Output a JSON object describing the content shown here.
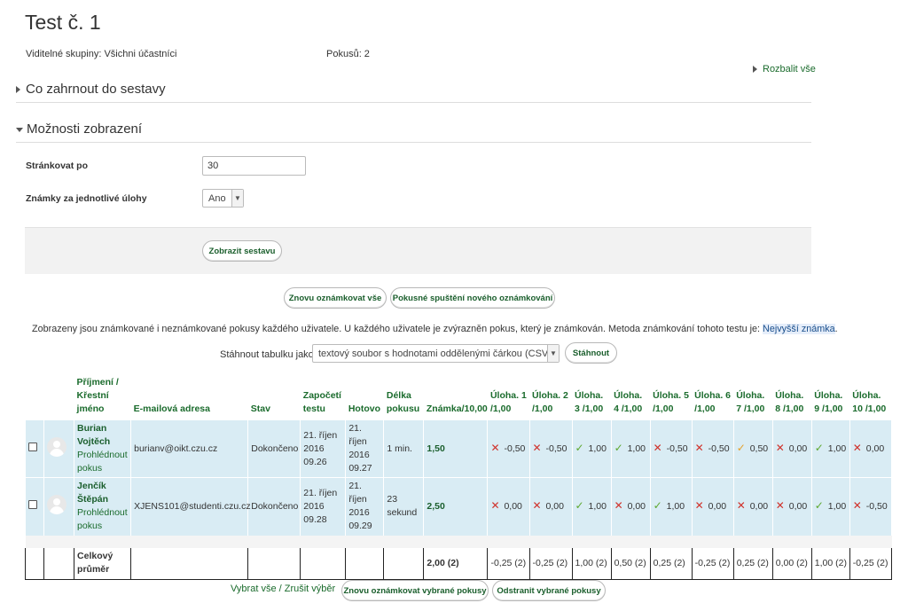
{
  "page": {
    "title": "Test č. 1",
    "groups_text": "Viditelné skupiny: Všichni účastníci",
    "attempts_text": "Pokusů: 2",
    "expand_all": "Rozbalit vše"
  },
  "sections": {
    "include": "Co zahrnout do sestavy",
    "display": "Možnosti zobrazení"
  },
  "form": {
    "page_size_label": "Stránkovat po",
    "page_size_value": "30",
    "marks_label": "Známky za jednotlivé úlohy",
    "marks_value": "Ano",
    "show_report_button": "Zobrazit sestavu"
  },
  "actions": {
    "regrade_all": "Znovu oznámkovat vše",
    "dry_run": "Pokusné spuštění nového oznámkování"
  },
  "info": {
    "text_before": "Zobrazeny jsou známkované i neznámkované pokusy každého uživatele. U každého uživatele je zvýrazněn pokus, který je známkován. Metoda známkování tohoto testu je: ",
    "method": "Nejvyšší známka",
    "text_after": "."
  },
  "download": {
    "label": "Stáhnout tabulku jako",
    "format": "textový soubor s hodnotami oddělenými čárkou (CSV)",
    "button": "Stáhnout"
  },
  "table": {
    "headers": {
      "name": "Příjmení / Křestní jméno",
      "email": "E-mailová adresa",
      "state": "Stav",
      "started": "Započetí testu",
      "finished": "Hotovo",
      "duration": "Délka pokusu",
      "grade": "Známka/10,00",
      "q1": "Úloha. 1 /1,00",
      "q2": "Úloha. 2 /1,00",
      "q3": "Úloha. 3 /1,00",
      "q4": "Úloha. 4 /1,00",
      "q5": "Úloha. 5 /1,00",
      "q6": "Úloha. 6 /1,00",
      "q7": "Úloha. 7 /1,00",
      "q8": "Úloha. 8 /1,00",
      "q9": "Úloha. 9 /1,00",
      "q10": "Úloha. 10 /1,00"
    },
    "rows": [
      {
        "name": "Burian Vojtěch",
        "review": "Prohlédnout pokus",
        "email": "burianv@oikt.czu.cz",
        "state": "Dokončeno",
        "started": "21. říjen 2016 09.26",
        "finished": "21. říjen 2016 09.27",
        "duration": "1 min.",
        "grade": "1,50",
        "q": [
          "-0,50",
          "-0,50",
          "1,00",
          "1,00",
          "-0,50",
          "-0,50",
          "0,50",
          "0,00",
          "1,00",
          "0,00"
        ],
        "qicon": [
          "x",
          "x",
          "ok",
          "ok",
          "x",
          "x",
          "part",
          "x",
          "ok",
          "x"
        ]
      },
      {
        "name": "Jenčík Štěpán",
        "review": "Prohlédnout pokus",
        "email": "XJENS101@studenti.czu.cz",
        "state": "Dokončeno",
        "started": "21. říjen 2016 09.28",
        "finished": "21. říjen 2016 09.29",
        "duration": "23 sekund",
        "grade": "2,50",
        "q": [
          "0,00",
          "0,00",
          "1,00",
          "0,00",
          "1,00",
          "0,00",
          "0,00",
          "0,00",
          "1,00",
          "-0,50"
        ],
        "qicon": [
          "x",
          "x",
          "ok",
          "x",
          "ok",
          "x",
          "x",
          "x",
          "ok",
          "x"
        ]
      }
    ],
    "average": {
      "label": "Celkový průměr",
      "grade": "2,00 (2)",
      "q": [
        "-0,25 (2)",
        "-0,25 (2)",
        "1,00 (2)",
        "0,50 (2)",
        "0,25 (2)",
        "-0,25 (2)",
        "0,25 (2)",
        "0,00 (2)",
        "1,00 (2)",
        "-0,25 (2)"
      ]
    }
  },
  "bottom": {
    "select_all": "Vybrat vše",
    "separator": " / ",
    "deselect": "Zrušit výběr",
    "regrade_selected": "Znovu oznámkovat vybrané pokusy",
    "delete_selected": "Odstranit vybrané pokusy"
  },
  "icons": {
    "wrong": "cross-icon",
    "correct": "check-icon",
    "partial": "partial-check-icon"
  },
  "colors": {
    "link": "#1a6b2c",
    "row_bg": "#d9ecf4",
    "wrong": "#d0322b",
    "correct": "#5ea830",
    "partial": "#e5a12a"
  }
}
